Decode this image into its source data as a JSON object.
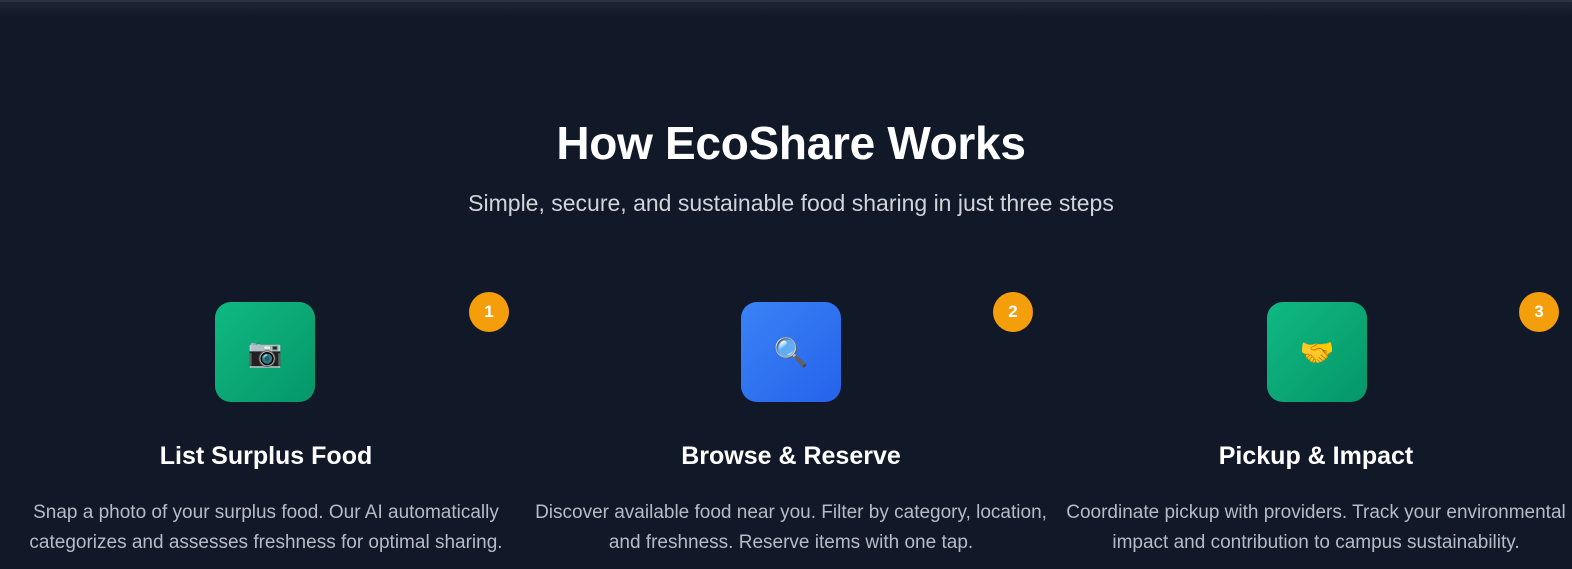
{
  "section": {
    "title": "How EcoShare Works",
    "subtitle": "Simple, secure, and sustainable food sharing in just three steps"
  },
  "steps": [
    {
      "number": "1",
      "icon": "camera-icon",
      "icon_glyph": "📷",
      "icon_color": "#10b981",
      "title": "List Surplus Food",
      "description": "Snap a photo of your surplus food. Our AI automatically categorizes and assesses freshness for optimal sharing."
    },
    {
      "number": "2",
      "icon": "magnifier-icon",
      "icon_glyph": "🔍",
      "icon_color": "#3b82f6",
      "title": "Browse & Reserve",
      "description": "Discover available food near you. Filter by category, location, and freshness. Reserve items with one tap."
    },
    {
      "number": "3",
      "icon": "handshake-icon",
      "icon_glyph": "🤝",
      "icon_color": "#10b981",
      "title": "Pickup & Impact",
      "description": "Coordinate pickup with providers. Track your environmental impact and contribution to campus sustainability."
    }
  ],
  "colors": {
    "background": "#111827",
    "badge": "#f59e0b",
    "green": "#10b981",
    "blue": "#3b82f6"
  }
}
